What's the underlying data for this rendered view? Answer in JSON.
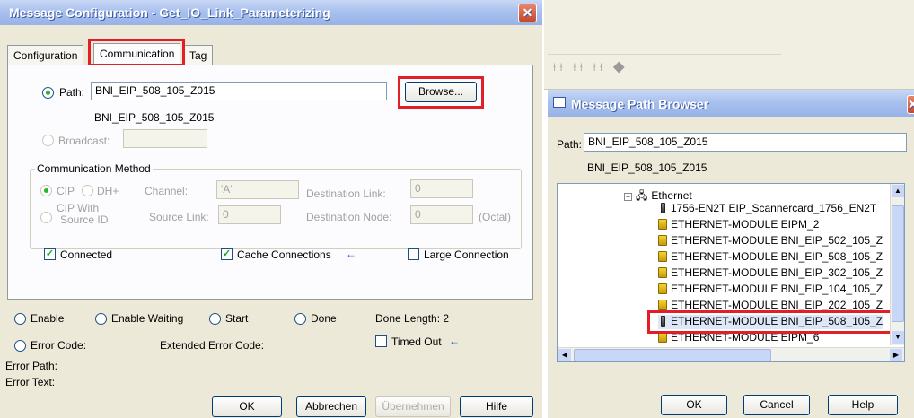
{
  "msg_config": {
    "title": "Message Configuration - Get_IO_Link_Parameterizing",
    "tabs": [
      "Configuration",
      "Communication",
      "Tag"
    ],
    "path_label": "Path:",
    "path_value": "BNI_EIP_508_105_Z015",
    "path_resolved": "BNI_EIP_508_105_Z015",
    "browse_label": "Browse...",
    "broadcast_label": "Broadcast:",
    "comm_method": {
      "title": "Communication Method",
      "cip": "CIP",
      "dhplus": "DH+",
      "channel_label": "Channel:",
      "channel_value": "'A'",
      "dest_link_label": "Destination Link:",
      "dest_link_value": "0",
      "cip_with_source_id": [
        "CIP With",
        "Source ID"
      ],
      "source_link_label": "Source Link:",
      "source_link_value": "0",
      "dest_node_label": "Destination Node:",
      "dest_node_value": "0",
      "octal": "(Octal)"
    },
    "connected_label": "Connected",
    "cache_label": "Cache Connections",
    "large_label": "Large Connection",
    "status": {
      "enable": "Enable",
      "enable_waiting": "Enable Waiting",
      "start": "Start",
      "done": "Done",
      "done_length": "Done Length: 2",
      "error_code": "Error Code:",
      "extended_error": "Extended Error Code:",
      "timed_out": "Timed Out",
      "error_path": "Error Path:",
      "error_text": "Error Text:"
    },
    "buttons": {
      "ok": "OK",
      "cancel": "Abbrechen",
      "apply": "Übernehmen",
      "help": "Hilfe"
    }
  },
  "path_browser": {
    "title": "Message Path Browser",
    "path_label": "Path:",
    "path_value": "BNI_EIP_508_105_Z015",
    "path_resolved": "BNI_EIP_508_105_Z015",
    "tree": [
      "Ethernet",
      "1756-EN2T EIP_Scannercard_1756_EN2T",
      "ETHERNET-MODULE EIPM_2",
      "ETHERNET-MODULE BNI_EIP_502_105_Z",
      "ETHERNET-MODULE BNI_EIP_508_105_Z",
      "ETHERNET-MODULE BNI_EIP_302_105_Z",
      "ETHERNET-MODULE BNI_EIP_104_105_Z",
      "ETHERNET-MODULE BNI_EIP_202_105_Z",
      "ETHERNET-MODULE BNI_EIP_508_105_Z",
      "ETHERNET-MODULE EIPM_6"
    ],
    "buttons": {
      "ok": "OK",
      "cancel": "Cancel",
      "help": "Help"
    }
  },
  "colors": {
    "highlight": "#e21f26",
    "title_gradient": "#97b2e6",
    "dialog_bg": "#ece9d8"
  }
}
